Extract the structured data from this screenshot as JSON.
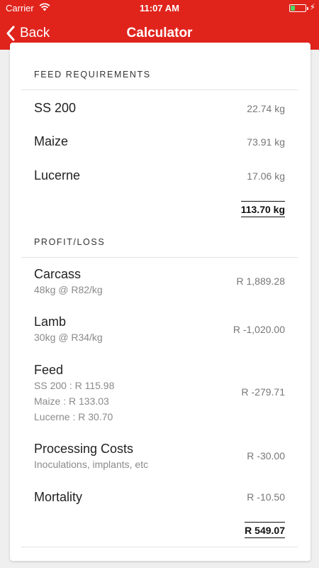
{
  "status": {
    "carrier": "Carrier",
    "time": "11:07 AM",
    "battery_level": 0.28
  },
  "nav": {
    "back_label": "Back",
    "title": "Calculator"
  },
  "feed": {
    "header": "FEED REQUIREMENTS",
    "items": [
      {
        "label": "SS 200",
        "value": "22.74 kg"
      },
      {
        "label": "Maize",
        "value": "73.91 kg"
      },
      {
        "label": "Lucerne",
        "value": "17.06 kg"
      }
    ],
    "total": "113.70 kg"
  },
  "profit": {
    "header": "PROFIT/LOSS",
    "carcass": {
      "label": "Carcass",
      "sub": "48kg @ R82/kg",
      "value": "R 1,889.28"
    },
    "lamb": {
      "label": "Lamb",
      "sub": "30kg @ R34/kg",
      "value": "R -1,020.00"
    },
    "feed": {
      "label": "Feed",
      "sub1": "SS 200 : R 115.98",
      "sub2": "Maize : R 133.03",
      "sub3": "Lucerne : R 30.70",
      "value": "R -279.71"
    },
    "processing": {
      "label": "Processing Costs",
      "sub": "Inoculations, implants, etc",
      "value": "R -30.00"
    },
    "mortality": {
      "label": "Mortality",
      "value": "R -10.50"
    },
    "total": "R 549.07"
  },
  "colors": {
    "accent": "#e0241c",
    "battery": "#4cd964"
  }
}
